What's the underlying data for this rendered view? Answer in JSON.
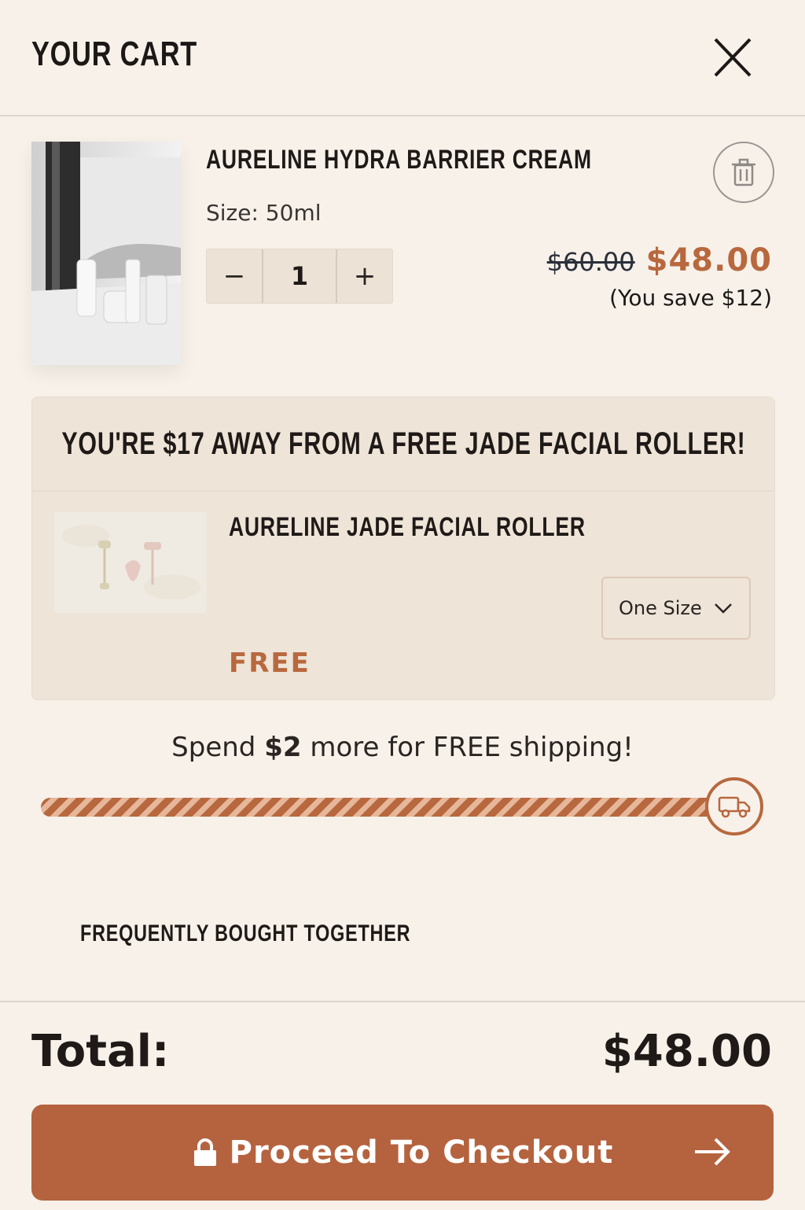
{
  "header": {
    "title": "YOUR CART"
  },
  "item": {
    "name": "AURELINE HYDRA BARRIER CREAM",
    "size": "Size: 50ml",
    "quantity": "1",
    "qty_minus": "−",
    "qty_plus": "+",
    "old_price": "$60.00",
    "price": "$48.00",
    "savings": "(You save $12)"
  },
  "gift": {
    "headline": "YOU'RE $17 AWAY FROM A FREE JADE FACIAL ROLLER!",
    "name": "AURELINE JADE FACIAL ROLLER",
    "size_option": "One Size",
    "price": "FREE"
  },
  "shipping": {
    "message_pre": "Spend ",
    "message_amount": "$2",
    "message_post": " more for FREE shipping!",
    "progress": 0.98
  },
  "fbt": {
    "title": "FREQUENTLY BOUGHT TOGETHER"
  },
  "footer": {
    "total_label": "Total:",
    "total_value": "$48.00",
    "checkout_label": "Proceed To Checkout"
  },
  "colors": {
    "accent": "#b8683e",
    "button": "#b5633f",
    "background": "#f7f1ea",
    "panel": "#eee4d8"
  },
  "icons": [
    "close-icon",
    "trash-icon",
    "truck-icon",
    "lock-icon",
    "arrow-right-icon",
    "chevron-down-icon"
  ]
}
